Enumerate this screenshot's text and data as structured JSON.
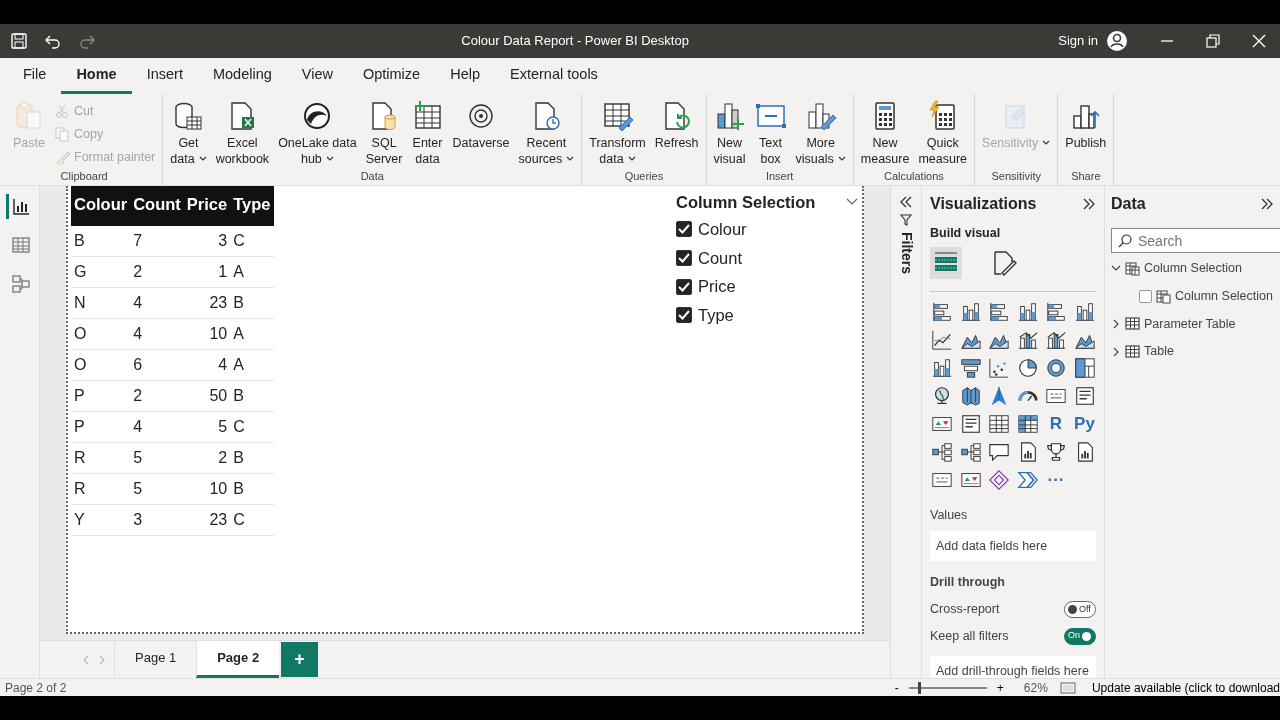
{
  "window": {
    "title": "Colour Data Report - Power BI Desktop",
    "sign_in": "Sign in"
  },
  "menu_tabs": [
    {
      "label": "File",
      "selected": false
    },
    {
      "label": "Home",
      "selected": true
    },
    {
      "label": "Insert",
      "selected": false
    },
    {
      "label": "Modeling",
      "selected": false
    },
    {
      "label": "View",
      "selected": false
    },
    {
      "label": "Optimize",
      "selected": false
    },
    {
      "label": "Help",
      "selected": false
    },
    {
      "label": "External tools",
      "selected": false
    }
  ],
  "ribbon_groups": [
    {
      "label": "Clipboard",
      "buttons": [
        {
          "kind": "large",
          "lines": [
            "Paste"
          ],
          "disabled": true,
          "dropdown": false
        },
        {
          "kind": "small",
          "lines": [
            "Cut"
          ],
          "disabled": true,
          "dropdown": false
        },
        {
          "kind": "small",
          "lines": [
            "Copy"
          ],
          "disabled": true,
          "dropdown": false
        },
        {
          "kind": "small",
          "lines": [
            "Format painter"
          ],
          "disabled": true,
          "dropdown": false
        }
      ]
    },
    {
      "label": "Data",
      "buttons": [
        {
          "kind": "large",
          "lines": [
            "Get",
            "data"
          ],
          "disabled": false,
          "dropdown": true
        },
        {
          "kind": "large",
          "lines": [
            "Excel",
            "workbook"
          ],
          "disabled": false,
          "dropdown": false
        },
        {
          "kind": "large",
          "lines": [
            "OneLake data",
            "hub"
          ],
          "disabled": false,
          "dropdown": true
        },
        {
          "kind": "large",
          "lines": [
            "SQL",
            "Server"
          ],
          "disabled": false,
          "dropdown": false
        },
        {
          "kind": "large",
          "lines": [
            "Enter",
            "data"
          ],
          "disabled": false,
          "dropdown": false
        },
        {
          "kind": "large",
          "lines": [
            "Dataverse"
          ],
          "disabled": false,
          "dropdown": false
        },
        {
          "kind": "large",
          "lines": [
            "Recent",
            "sources"
          ],
          "disabled": false,
          "dropdown": true
        }
      ]
    },
    {
      "label": "Queries",
      "buttons": [
        {
          "kind": "large",
          "lines": [
            "Transform",
            "data"
          ],
          "disabled": false,
          "dropdown": true
        },
        {
          "kind": "large",
          "lines": [
            "Refresh"
          ],
          "disabled": false,
          "dropdown": false
        }
      ]
    },
    {
      "label": "Insert",
      "buttons": [
        {
          "kind": "large",
          "lines": [
            "New",
            "visual"
          ],
          "disabled": false,
          "dropdown": false
        },
        {
          "kind": "large",
          "lines": [
            "Text",
            "box"
          ],
          "disabled": false,
          "dropdown": false
        },
        {
          "kind": "large",
          "lines": [
            "More",
            "visuals"
          ],
          "disabled": false,
          "dropdown": true
        }
      ]
    },
    {
      "label": "Calculations",
      "buttons": [
        {
          "kind": "large",
          "lines": [
            "New",
            "measure"
          ],
          "disabled": false,
          "dropdown": false
        },
        {
          "kind": "large",
          "lines": [
            "Quick",
            "measure"
          ],
          "disabled": false,
          "dropdown": false
        }
      ]
    },
    {
      "label": "Sensitivity",
      "buttons": [
        {
          "kind": "large",
          "lines": [
            "Sensitivity"
          ],
          "disabled": true,
          "dropdown": true
        }
      ]
    },
    {
      "label": "Share",
      "buttons": [
        {
          "kind": "large",
          "lines": [
            "Publish"
          ],
          "disabled": false,
          "dropdown": false
        }
      ]
    }
  ],
  "views": [
    {
      "kind": "report",
      "selected": true
    },
    {
      "kind": "table",
      "selected": false
    },
    {
      "kind": "model",
      "selected": false
    }
  ],
  "table_visual": {
    "columns": [
      {
        "label": "Colour",
        "kind": "text"
      },
      {
        "label": "Count",
        "kind": "text"
      },
      {
        "label": "Price",
        "kind": "number"
      },
      {
        "label": "Type",
        "kind": "text"
      }
    ],
    "rows": [
      [
        "B",
        "7",
        "3",
        "C"
      ],
      [
        "G",
        "2",
        "1",
        "A"
      ],
      [
        "N",
        "4",
        "23",
        "B"
      ],
      [
        "O",
        "4",
        "10",
        "A"
      ],
      [
        "O",
        "6",
        "4",
        "A"
      ],
      [
        "P",
        "2",
        "50",
        "B"
      ],
      [
        "P",
        "4",
        "5",
        "C"
      ],
      [
        "R",
        "5",
        "2",
        "B"
      ],
      [
        "R",
        "5",
        "10",
        "B"
      ],
      [
        "Y",
        "3",
        "23",
        "C"
      ]
    ]
  },
  "slicer": {
    "title": "Column Selection",
    "items": [
      {
        "label": "Colour",
        "checked": true
      },
      {
        "label": "Count",
        "checked": true
      },
      {
        "label": "Price",
        "checked": true
      },
      {
        "label": "Type",
        "checked": true
      }
    ]
  },
  "filters_pane": {
    "label": "Filters"
  },
  "visualizations": {
    "title": "Visualizations",
    "subtitle": "Build visual",
    "build_tabs": [
      {
        "kind": "fields",
        "selected": true
      },
      {
        "kind": "format",
        "selected": false
      }
    ],
    "gallery": [
      {
        "kind": "hbar"
      },
      {
        "kind": "vbar"
      },
      {
        "kind": "hbar"
      },
      {
        "kind": "vbar"
      },
      {
        "kind": "hbar"
      },
      {
        "kind": "vbar"
      },
      {
        "kind": "line"
      },
      {
        "kind": "area"
      },
      {
        "kind": "area"
      },
      {
        "kind": "combo"
      },
      {
        "kind": "combo"
      },
      {
        "kind": "area"
      },
      {
        "kind": "vbar"
      },
      {
        "kind": "funnel"
      },
      {
        "kind": "scatter"
      },
      {
        "kind": "pie"
      },
      {
        "kind": "donut"
      },
      {
        "kind": "treemap"
      },
      {
        "kind": "globe"
      },
      {
        "kind": "map"
      },
      {
        "kind": "arrow"
      },
      {
        "kind": "gauge"
      },
      {
        "kind": "card"
      },
      {
        "kind": "list"
      },
      {
        "kind": "kpi"
      },
      {
        "kind": "list"
      },
      {
        "kind": "table"
      },
      {
        "kind": "grid"
      },
      {
        "kind": "text",
        "label": "R"
      },
      {
        "kind": "text",
        "label": "Py"
      },
      {
        "kind": "tree"
      },
      {
        "kind": "tree"
      },
      {
        "kind": "speech"
      },
      {
        "kind": "doc"
      },
      {
        "kind": "trophy"
      },
      {
        "kind": "doc"
      },
      {
        "kind": "card"
      },
      {
        "kind": "kpi"
      },
      {
        "kind": "diamond"
      },
      {
        "kind": "chevron"
      },
      {
        "kind": "text",
        "label": "···"
      }
    ],
    "wells": [
      {
        "label": "Values",
        "hint": "Add data fields here"
      }
    ],
    "drill_through": {
      "title": "Drill through",
      "toggles": [
        {
          "label": "Cross-report",
          "on": false,
          "text": "Off"
        },
        {
          "label": "Keep all filters",
          "on": true,
          "text": "On"
        }
      ],
      "hint": "Add drill-through fields here"
    }
  },
  "data_pane": {
    "title": "Data",
    "search": {
      "placeholder": "Search"
    },
    "tree": [
      {
        "label": "Column Selection",
        "kind": "parameter",
        "expanded": true,
        "children": [
          {
            "label": "Column Selection",
            "kind": "field",
            "checked": false
          }
        ]
      },
      {
        "label": "Parameter Table",
        "kind": "table",
        "expanded": false
      },
      {
        "label": "Table",
        "kind": "table",
        "expanded": false
      }
    ]
  },
  "pages": [
    {
      "label": "Page 1",
      "selected": false
    },
    {
      "label": "Page 2",
      "selected": true
    }
  ],
  "add_page": "+",
  "status_bar": {
    "page_info": "Page 2 of 2",
    "zoom_out": "-",
    "zoom_in": "+",
    "zoom": {
      "level": 0.12,
      "reading": "62%"
    },
    "update": "Update available (click to download"
  }
}
